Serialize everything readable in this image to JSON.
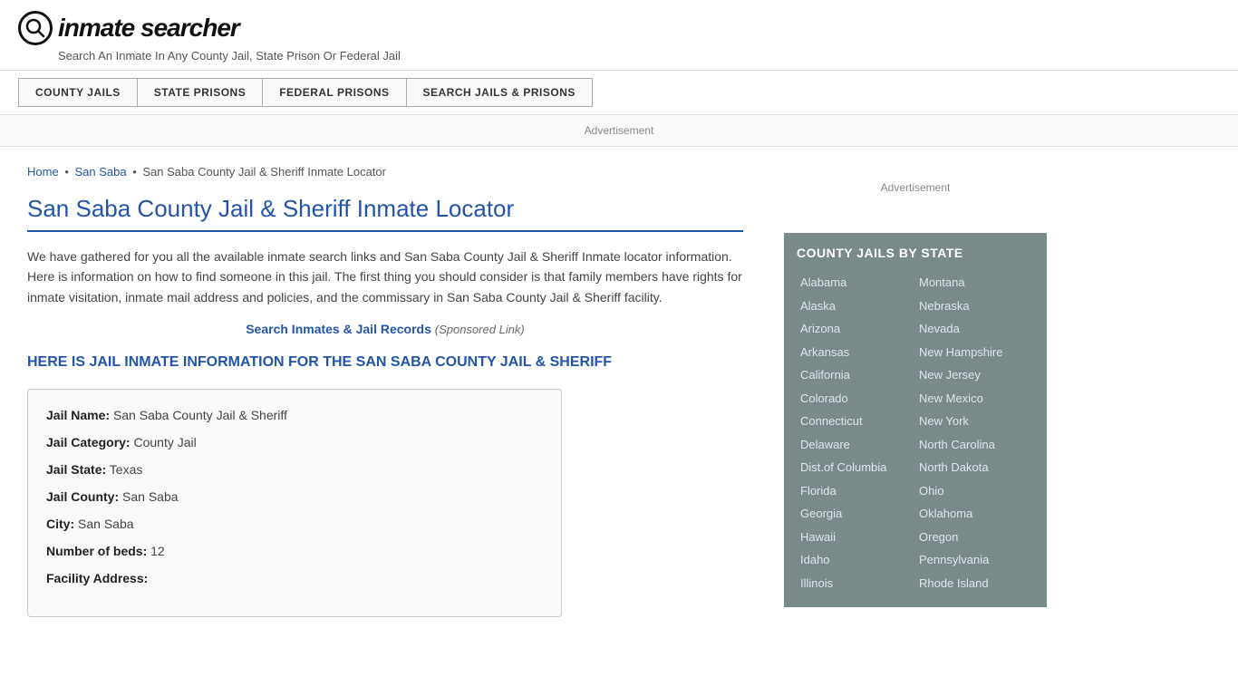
{
  "header": {
    "logo_icon": "🔍",
    "logo_text": "inmate searcher",
    "tagline": "Search An Inmate In Any County Jail, State Prison Or Federal Jail"
  },
  "nav": {
    "buttons": [
      {
        "label": "COUNTY JAILS",
        "id": "county-jails"
      },
      {
        "label": "STATE PRISONS",
        "id": "state-prisons"
      },
      {
        "label": "FEDERAL PRISONS",
        "id": "federal-prisons"
      },
      {
        "label": "SEARCH JAILS & PRISONS",
        "id": "search-jails"
      }
    ]
  },
  "ad": {
    "top_label": "Advertisement",
    "sidebar_label": "Advertisement"
  },
  "breadcrumb": {
    "home": "Home",
    "parent": "San Saba",
    "current": "San Saba County Jail & Sheriff Inmate Locator"
  },
  "page": {
    "title": "San Saba County Jail & Sheriff Inmate Locator",
    "description": "We have gathered for you all the available inmate search links and San Saba County Jail & Sheriff Inmate locator information. Here is information on how to find someone in this jail. The first thing you should consider is that family members have rights for inmate visitation, inmate mail address and policies, and the commissary in San Saba County Jail & Sheriff facility.",
    "sponsored_link_text": "Search Inmates & Jail Records",
    "sponsored_suffix": "(Sponsored Link)",
    "section_heading": "HERE IS JAIL INMATE INFORMATION FOR THE SAN SABA COUNTY JAIL & SHERIFF"
  },
  "jail_info": {
    "name_label": "Jail Name:",
    "name_value": "San Saba County Jail & Sheriff",
    "category_label": "Jail Category:",
    "category_value": "County Jail",
    "state_label": "Jail State:",
    "state_value": "Texas",
    "county_label": "Jail County:",
    "county_value": "San Saba",
    "city_label": "City:",
    "city_value": "San Saba",
    "beds_label": "Number of beds:",
    "beds_value": "12",
    "address_label": "Facility Address:"
  },
  "sidebar": {
    "state_list_title": "COUNTY JAILS BY STATE",
    "left_states": [
      "Alabama",
      "Alaska",
      "Arizona",
      "Arkansas",
      "California",
      "Colorado",
      "Connecticut",
      "Delaware",
      "Dist.of Columbia",
      "Florida",
      "Georgia",
      "Hawaii",
      "Idaho",
      "Illinois"
    ],
    "right_states": [
      "Montana",
      "Nebraska",
      "Nevada",
      "New Hampshire",
      "New Jersey",
      "New Mexico",
      "New York",
      "North Carolina",
      "North Dakota",
      "Ohio",
      "Oklahoma",
      "Oregon",
      "Pennsylvania",
      "Rhode Island"
    ]
  }
}
